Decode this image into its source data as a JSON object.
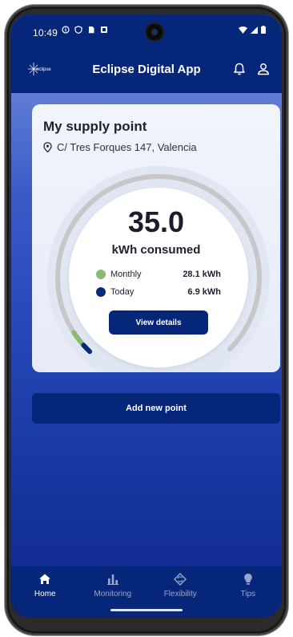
{
  "status_bar": {
    "time": "10:49"
  },
  "app_bar": {
    "logo_text": "eclipse",
    "title": "Eclipse Digital App"
  },
  "supply_card": {
    "title": "My supply point",
    "address": "C/ Tres Forques 147, Valencia",
    "consumption_value": "35.0",
    "consumption_unit": "kWh consumed",
    "legend": [
      {
        "label": "Monthly",
        "value": "28.1 kWh",
        "color": "#8bb872"
      },
      {
        "label": "Today",
        "value": "6.9 kWh",
        "color": "#0a2a7e"
      }
    ],
    "details_button": "View details"
  },
  "add_button": "Add new point",
  "bottom_nav": [
    {
      "label": "Home",
      "icon": "home-icon",
      "active": true
    },
    {
      "label": "Monitoring",
      "icon": "bar-chart-icon",
      "active": false
    },
    {
      "label": "Flexibility",
      "icon": "sync-icon",
      "active": false
    },
    {
      "label": "Tips",
      "icon": "lightbulb-icon",
      "active": false
    }
  ],
  "colors": {
    "primary": "#06267a",
    "monthly": "#8bb872",
    "today": "#0a2a7e",
    "gauge_track": "#c7c7c7"
  }
}
